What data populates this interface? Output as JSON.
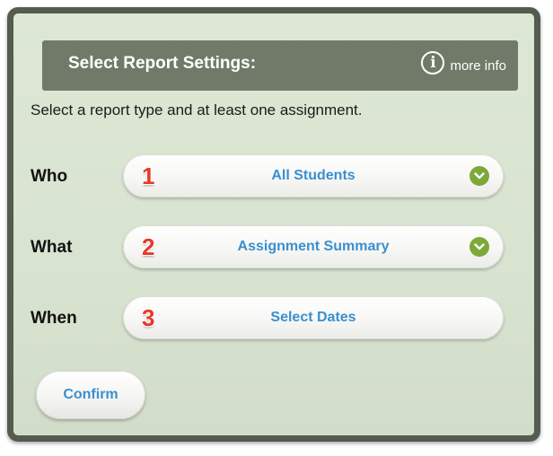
{
  "header": {
    "title": "Select Report Settings:",
    "info_label": "more info"
  },
  "instruction": "Select a report type and at least one assignment.",
  "rows": [
    {
      "label": "Who",
      "step": "1",
      "value": "All Students",
      "has_chevron": true
    },
    {
      "label": "What",
      "step": "2",
      "value": "Assignment Summary",
      "has_chevron": true
    },
    {
      "label": "When",
      "step": "3",
      "value": "Select Dates",
      "has_chevron": false
    }
  ],
  "confirm_label": "Confirm",
  "colors": {
    "panel_border": "#545b4f",
    "panel_bg": "#dde7d4",
    "header_bg": "#717a68",
    "link_blue": "#3a8fd0",
    "step_red": "#e8382b",
    "chevron_green": "#7ea83a"
  },
  "icons": {
    "info": "info-circle-icon",
    "dropdown": "chevron-down-icon"
  }
}
